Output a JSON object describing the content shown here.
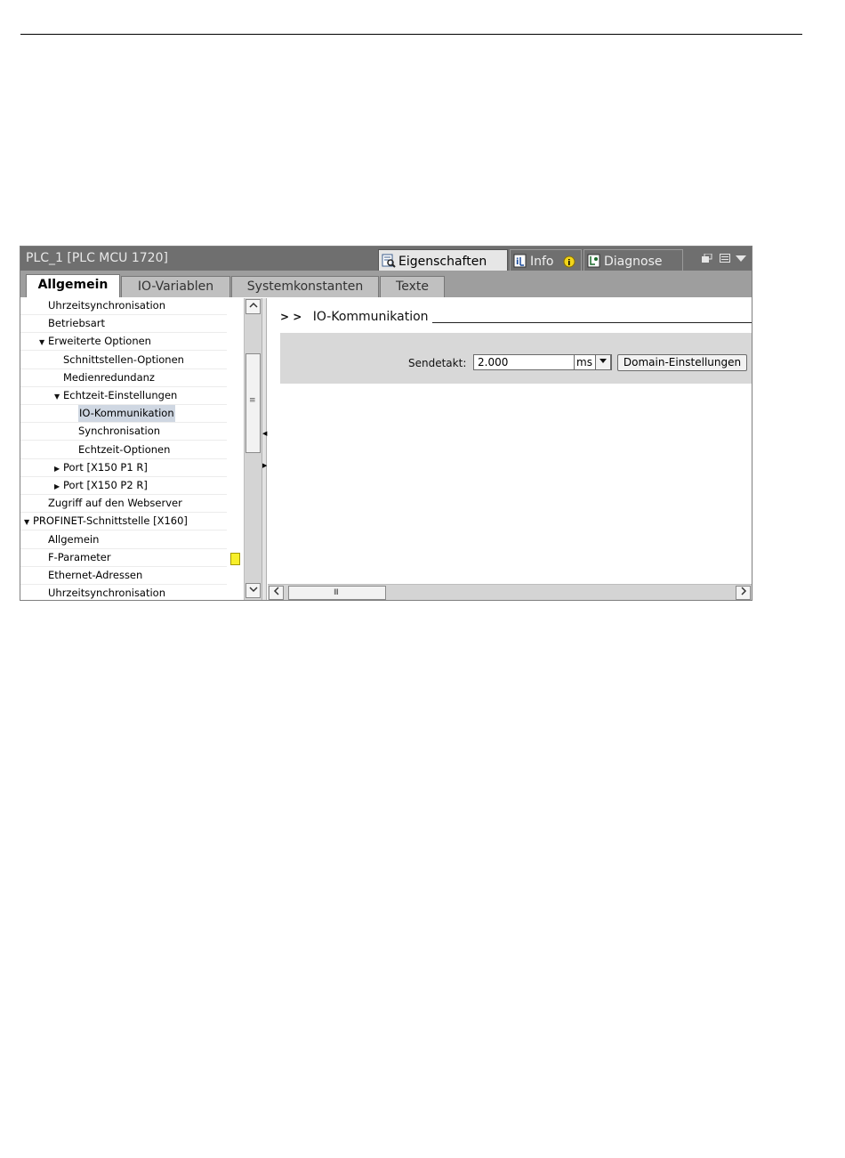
{
  "panel": {
    "title": "PLC_1 [PLC MCU 1720]",
    "tabs": [
      {
        "label": "Eigenschaften",
        "icon": "properties-icon",
        "active": true
      },
      {
        "label": "Info",
        "icon": "info-icon",
        "badge_icon": "info-badge-icon",
        "active": false
      },
      {
        "label": "Diagnose",
        "icon": "diagnose-icon",
        "active": false
      }
    ],
    "controls": [
      "restore-window-icon",
      "list-icon",
      "dropdown-arrow-icon"
    ]
  },
  "subtabs": [
    "Allgemein",
    "IO-Variablen",
    "Systemkonstanten",
    "Texte"
  ],
  "tree": [
    {
      "label": "Uhrzeitsynchronisation",
      "level": 2,
      "expander": ""
    },
    {
      "label": "Betriebsart",
      "level": 2,
      "expander": ""
    },
    {
      "label": "Erweiterte Optionen",
      "level": 2,
      "expander": "▼"
    },
    {
      "label": "Schnittstellen-Optionen",
      "level": 3,
      "expander": ""
    },
    {
      "label": "Medienredundanz",
      "level": 3,
      "expander": ""
    },
    {
      "label": "Echtzeit-Einstellungen",
      "level": 3,
      "expander": "▼"
    },
    {
      "label": "IO-Kommunikation",
      "level": 4,
      "expander": "",
      "selected": true
    },
    {
      "label": "Synchronisation",
      "level": 4,
      "expander": ""
    },
    {
      "label": "Echtzeit-Optionen",
      "level": 4,
      "expander": ""
    },
    {
      "label": "Port [X150 P1 R]",
      "level": 3,
      "expander": "▶"
    },
    {
      "label": "Port [X150 P2 R]",
      "level": 3,
      "expander": "▶"
    },
    {
      "label": "Zugriff auf den Webserver",
      "level": 2,
      "expander": ""
    },
    {
      "label": "PROFINET-Schnittstelle [X160]",
      "level": 1,
      "expander": "▼"
    },
    {
      "label": "Allgemein",
      "level": 2,
      "expander": ""
    },
    {
      "label": "F-Parameter",
      "level": 2,
      "expander": ""
    },
    {
      "label": "Ethernet-Adressen",
      "level": 2,
      "expander": ""
    },
    {
      "label": "Uhrzeitsynchronisation",
      "level": 2,
      "expander": ""
    }
  ],
  "content": {
    "section_chevrons": "> >",
    "section_title": "IO-Kommunikation",
    "sendetakt_label": "Sendetakt:",
    "sendetakt_value": "2.000",
    "unit": "ms",
    "domain_button": "Domain-Einstellungen"
  },
  "colors": {
    "titlebar": "#6f6f6f",
    "flag": "#f7ef2a",
    "selection": "#cfd7e2"
  }
}
